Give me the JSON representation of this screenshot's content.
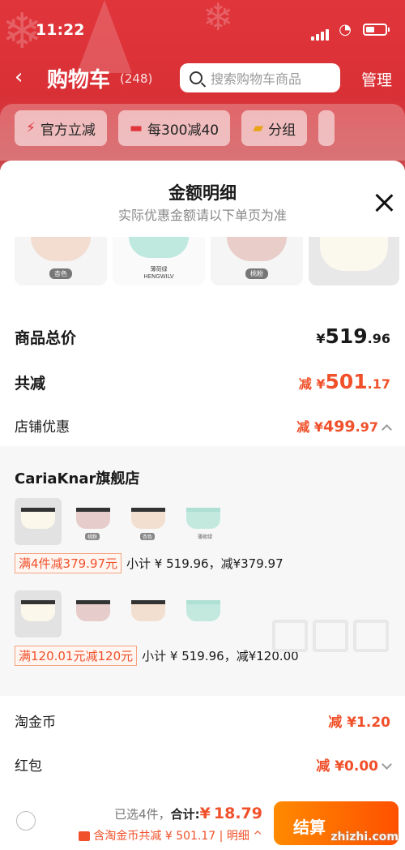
{
  "status": {
    "time": "11:22"
  },
  "nav": {
    "back_icon": "‹",
    "title": "购物车",
    "count": "(248)",
    "search_placeholder": "搜索购物车商品",
    "manage": "管理"
  },
  "chips": [
    {
      "icon": "lightning-icon",
      "glyph": "⚡",
      "label": "官方立减"
    },
    {
      "icon": "coupon-icon",
      "glyph": "▬",
      "label": "每300减40"
    },
    {
      "icon": "folder-icon",
      "glyph": "▰",
      "label": "分组"
    }
  ],
  "sheet": {
    "title": "金额明细",
    "subtitle": "实际优惠金额请以下单页为准",
    "thumb_tags": [
      "杏色",
      "薄荷绿\nHENGWILV",
      "桃粉",
      ""
    ],
    "total_label": "商品总价",
    "total_prefix": "¥",
    "total_main": "519",
    "total_dec": ".96",
    "discount_label": "共减",
    "discount_prefix": "减 ¥",
    "discount_main": "501",
    "discount_dec": ".17",
    "store_label": "店铺优惠",
    "store_prefix": "减 ¥",
    "store_main": "499",
    "store_dec": ".97",
    "shop_name": "CariaKnar旗舰店",
    "groups": [
      {
        "tag": "满4件减379.97元",
        "text": "小计 ¥ 519.96，减¥379.97"
      },
      {
        "tag": "满120.01元减120元",
        "text": "小计 ¥ 519.96，减¥120.00"
      }
    ],
    "item_labels": [
      "",
      "桃粉",
      "杏色",
      "薄荷绿"
    ],
    "coin_label": "淘金币",
    "coin_value": "减 ¥1.20",
    "redpacket_label": "红包",
    "redpacket_value": "减 ¥0.00"
  },
  "bottom": {
    "selected": "已选4件，",
    "total_label": "合计:",
    "currency": "¥",
    "total": "18.79",
    "detail": "含淘金币共减 ¥ 501.17 | 明细 ^",
    "checkout": "结算",
    "watermark": "zhizhi.com"
  },
  "colors": {
    "header_red": "#e0353b",
    "accent": "#f0502a",
    "checkout": "#ff5000"
  }
}
